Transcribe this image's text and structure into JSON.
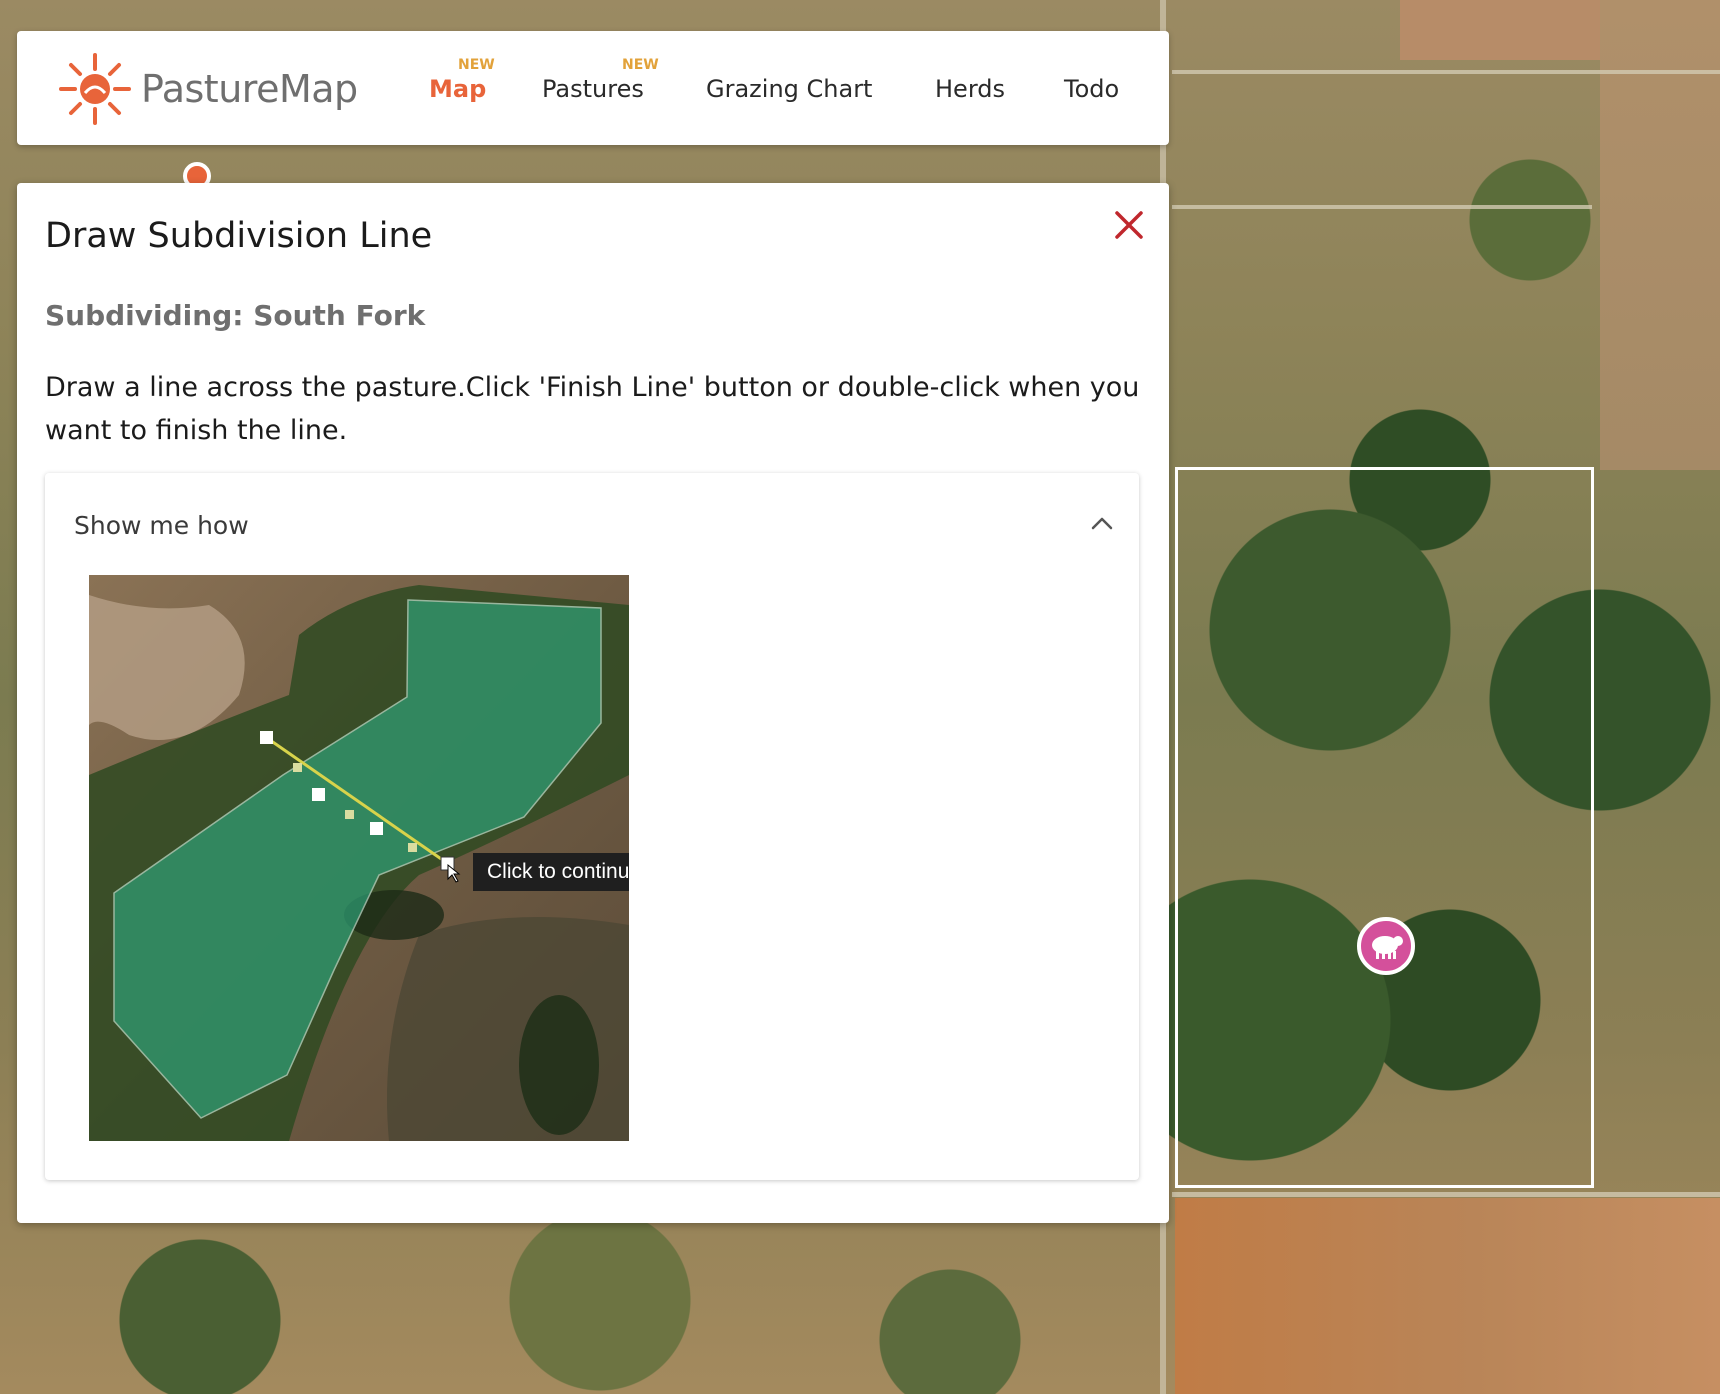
{
  "app": {
    "logo_text": "PastureMap",
    "logo_icon": "sun-icon",
    "accent_color": "#e8643a",
    "badge_color": "#e2a23a"
  },
  "nav": {
    "items": [
      {
        "label": "Map",
        "badge": "NEW",
        "active": true
      },
      {
        "label": "Pastures",
        "badge": "NEW",
        "active": false
      },
      {
        "label": "Grazing Chart",
        "badge": "",
        "active": false
      },
      {
        "label": "Herds",
        "badge": "",
        "active": false
      },
      {
        "label": "Todo",
        "badge": "",
        "active": false
      }
    ]
  },
  "panel": {
    "title": "Draw Subdivision Line",
    "close_icon": "close-icon",
    "subtitle": "Subdividing: South Fork",
    "instructions": "Draw a line across the pasture.Click 'Finish Line' button or double-click when you want to finish the line.",
    "howto": {
      "title": "Show me how",
      "expanded": true,
      "chevron_icon": "chevron-up-icon",
      "tooltip": "Click to continue"
    }
  },
  "map": {
    "herd_marker_icon": "sheep-icon",
    "herd_marker_color": "#d4509b"
  }
}
